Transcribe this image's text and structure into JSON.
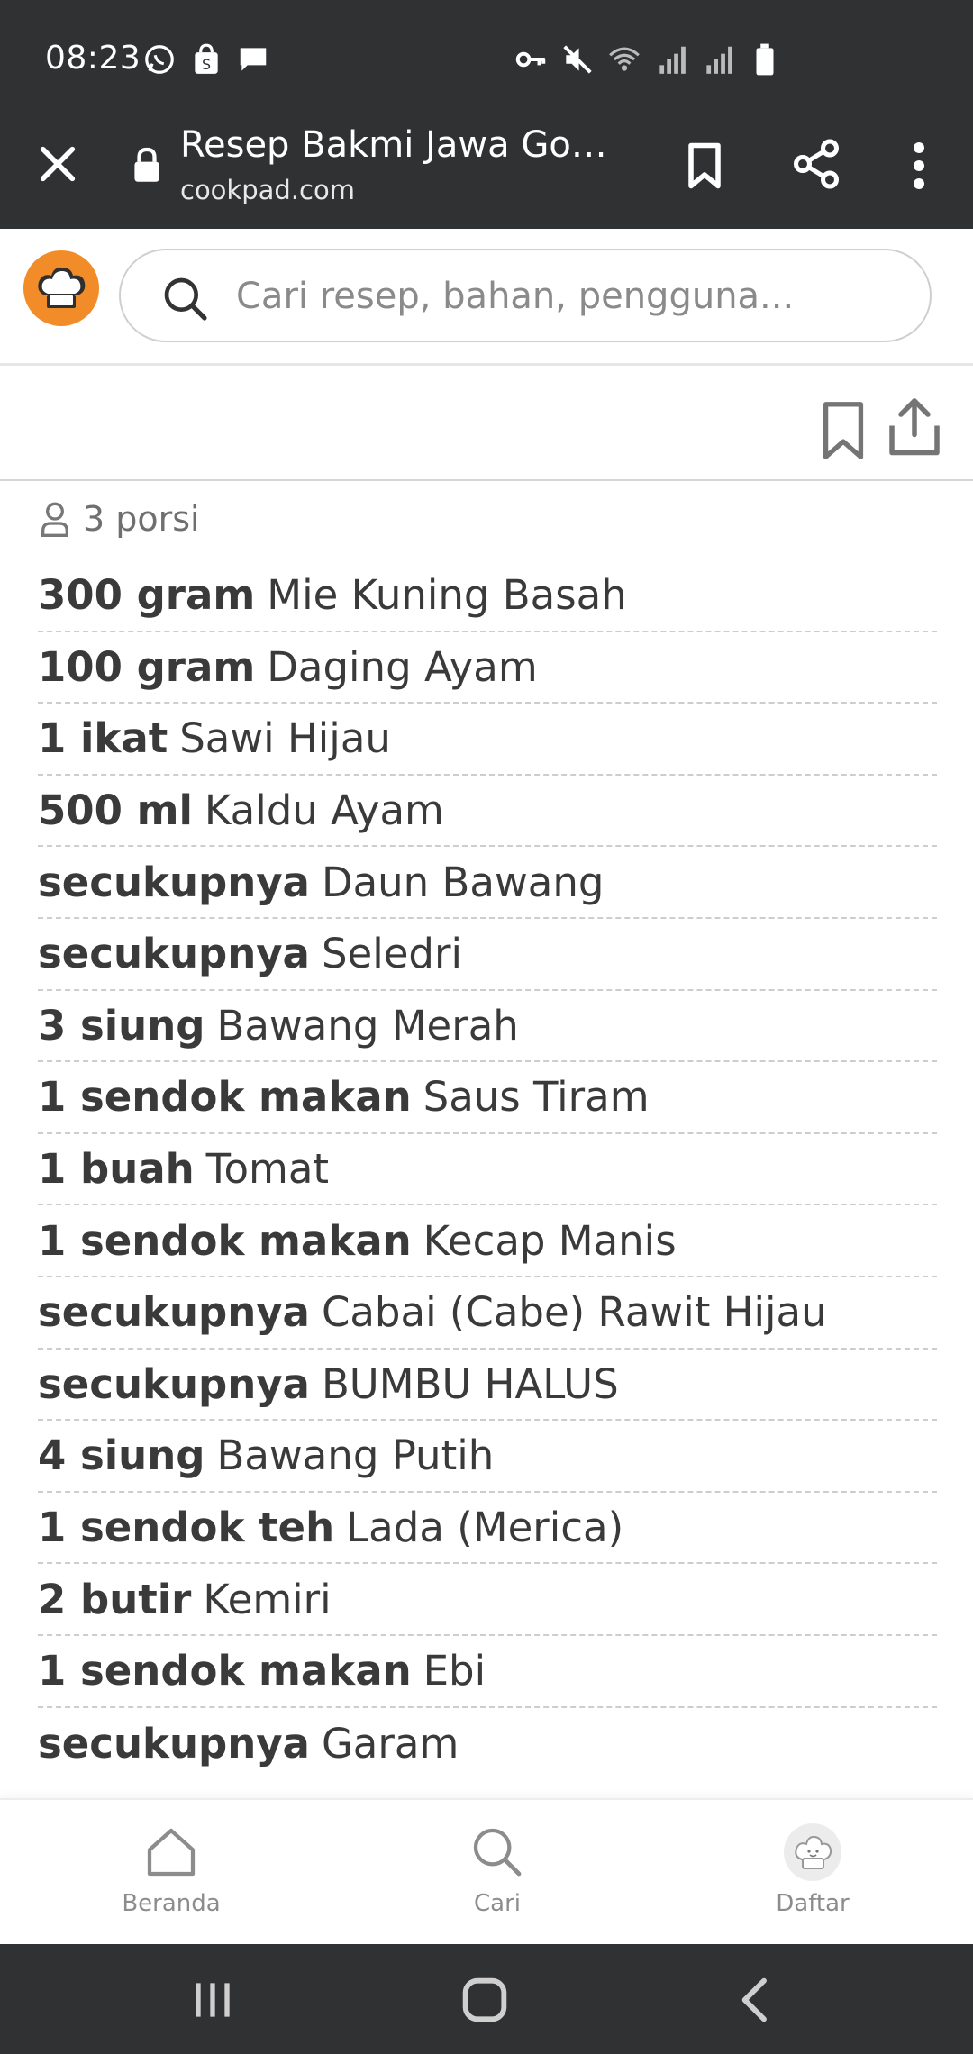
{
  "status_bar": {
    "time": "08:23",
    "left_icons": [
      "whatsapp-icon",
      "shopee-icon",
      "message-icon"
    ],
    "right_icons": [
      "vpn-key-icon",
      "mute-icon",
      "wifi-icon",
      "signal-icon",
      "signal-icon-2",
      "battery-icon"
    ]
  },
  "browser": {
    "title": "Resep Bakmi Jawa Godog",
    "url": "cookpad.com"
  },
  "header": {
    "search_placeholder": "Cari resep, bahan, pengguna..."
  },
  "recipe": {
    "servings": "3 porsi",
    "ingredients": [
      {
        "qty": "300 gram",
        "name": "Mie Kuning Basah"
      },
      {
        "qty": "100 gram",
        "name": "Daging Ayam"
      },
      {
        "qty": "1 ikat",
        "name": "Sawi Hijau"
      },
      {
        "qty": "500 ml",
        "name": "Kaldu Ayam"
      },
      {
        "qty": "secukupnya",
        "name": "Daun Bawang"
      },
      {
        "qty": "secukupnya",
        "name": "Seledri"
      },
      {
        "qty": "3 siung",
        "name": "Bawang Merah"
      },
      {
        "qty": "1 sendok makan",
        "name": "Saus Tiram"
      },
      {
        "qty": "1 buah",
        "name": "Tomat"
      },
      {
        "qty": "1 sendok makan",
        "name": "Kecap Manis"
      },
      {
        "qty": "secukupnya",
        "name": "Cabai (Cabe) Rawit Hijau"
      },
      {
        "qty": "secukupnya",
        "name": "BUMBU HALUS"
      },
      {
        "qty": "4 siung",
        "name": "Bawang Putih"
      },
      {
        "qty": "1 sendok teh",
        "name": "Lada (Merica)"
      },
      {
        "qty": "2 butir",
        "name": "Kemiri"
      },
      {
        "qty": "1 sendok makan",
        "name": "Ebi"
      },
      {
        "qty": "secukupnya",
        "name": "Garam"
      }
    ]
  },
  "bottom_nav": {
    "home": "Beranda",
    "search": "Cari",
    "list": "Daftar"
  },
  "colors": {
    "brand": "#f28c28",
    "topbar": "#2f3133"
  }
}
